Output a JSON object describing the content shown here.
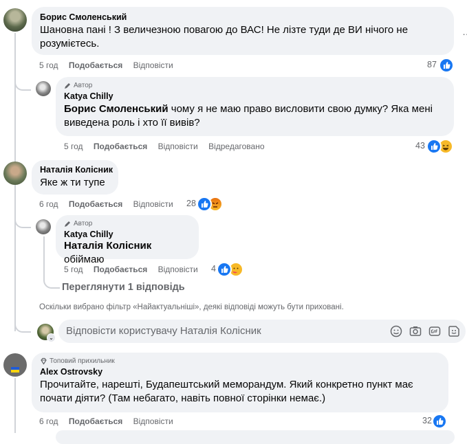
{
  "comments": [
    {
      "author": "Борис Смоленський",
      "text": "Шановна пані ! З величезною повагою до ВАС! Не лізте туди де ВИ нічого не розумієтесь.",
      "time": "5 год",
      "like": "Подобається",
      "reply": "Відповісти",
      "count": "87"
    },
    {
      "badge": "Автор",
      "author": "Katya Chilly",
      "mention": "Борис Смоленський",
      "text": " чому я не маю право висловити свою думку? Яка мені виведена роль і хто її вивів?",
      "time": "5 год",
      "like": "Подобається",
      "reply": "Відповісти",
      "edited": "Відредаговано",
      "count": "43"
    },
    {
      "author": "Наталія Колісник",
      "text": "Яке ж ти тупе",
      "time": "6 год",
      "like": "Подобається",
      "reply": "Відповісти",
      "count": "28"
    },
    {
      "badge": "Автор",
      "author": "Katya Chilly",
      "mention": "Наталія Колісник",
      "text": " обіймаю",
      "time": "5 год",
      "like": "Подобається",
      "reply": "Відповісти",
      "count": "4"
    },
    {
      "badge": "Топовий прихильник",
      "author": "Alex Ostrovsky",
      "text": "Прочитайте, нарешті, Будапештський меморандум. Який конкретно пункт має почати діяти? (Там небагато, навіть повної сторінки немає.)",
      "time": "6 год",
      "like": "Подобається",
      "reply": "Відповісти",
      "count": "32"
    }
  ],
  "view_more": "Переглянути 1 відповідь",
  "filter_note": "Оскільки вибрано фільтр «Найактуальніші», деякі відповіді можуть бути приховані.",
  "reply_input": {
    "placeholder": "Відповісти користувачу Наталія Колісник"
  },
  "icons": [
    "edit-pencil-icon",
    "like-icon",
    "haha-icon",
    "angry-icon",
    "care-icon",
    "emoji-icon",
    "camera-icon",
    "gif-icon",
    "sticker-icon",
    "diamond-icon",
    "more-dots-icon"
  ],
  "colors": {
    "like_blue": "#1877f2",
    "bubble": "#f0f2f5",
    "meta": "#65676b"
  }
}
